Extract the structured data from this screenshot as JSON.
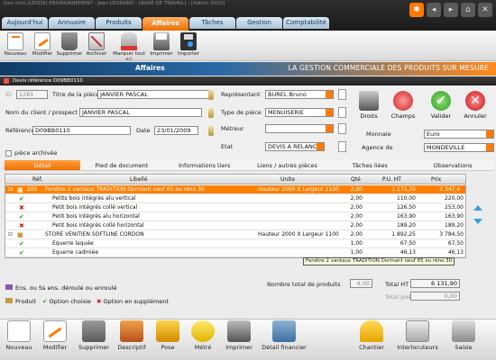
{
  "window": {
    "title": "Gen.com [LEXOS] ENVIRONNEMENT - Jean LEONARD - [BASE DE TRAVAIL] - [Admin 2010]"
  },
  "tabs": [
    "Aujourd'hui",
    "Annuaire",
    "Produits",
    "Affaires",
    "Tâches",
    "Gestion",
    "Comptabilité"
  ],
  "active_tab": "Affaires",
  "toolbar": {
    "items": [
      "Nouveau",
      "Modifier",
      "Supprimer",
      "Archiver",
      "Marquer tout +/-",
      "Imprimer",
      "Importer"
    ]
  },
  "section": {
    "label": "Affaires",
    "slogan": "LA GESTION COMMERCIALE DES PRODUITS SUR MESURE"
  },
  "devis": {
    "title": "Devis référence D09BB0110"
  },
  "form": {
    "id_label": "ID",
    "id_value": "1281",
    "titre_label": "Titre de la pièce",
    "titre_value": "JANVIER PASCAL",
    "client_label": "Nom du client / prospect",
    "client_value": "JANVIER PASCAL",
    "reference_label": "Référence",
    "reference_value": "D09BB0110",
    "date_label": "Date",
    "date_value": "23/01/2009",
    "representant_label": "Représentant",
    "representant_value": "BUREL Bruno",
    "type_label": "Type de pièce",
    "type_value": "MENUISERIE",
    "metreur_label": "Métreur",
    "metreur_value": "",
    "etat_label": "Etat",
    "etat_value": "DEVIS A RELANCER",
    "monnaie_label": "Monnaie",
    "monnaie_value": "Euro",
    "agence_label": "Agence de",
    "agence_value": "MONDEVILLE",
    "archive_label": "pièce archivée"
  },
  "actions": {
    "droits": "Droits",
    "champs": "Champs",
    "valider": "Valider",
    "annuler": "Annuler"
  },
  "subtabs": [
    "Détail",
    "Pied de document",
    "Informations tiers",
    "Liens / autres pièces",
    "Tâches liées",
    "Observations"
  ],
  "grid": {
    "headers": {
      "ref": "Réf.",
      "libelle": "Libellé",
      "unite": "Unite",
      "qte": "Qté",
      "pu": "P.U. HT",
      "prix": "Prix"
    },
    "rows": [
      {
        "mark": "pkg",
        "ref": "205",
        "libelle": "Fenêtre 2 vantaux TRADITION Dormant neuf 65 ou réno 30",
        "unite": "Hauteur 2000 X Largeur 1100",
        "qte": "2,00",
        "pu": "1 173,70",
        "prix": "2 347,40",
        "selected": true
      },
      {
        "mark": "check",
        "ref": "",
        "libelle": "Petits bois intégrés alu vertical",
        "unite": "",
        "qte": "2,00",
        "pu": "110,00",
        "prix": "220,00"
      },
      {
        "mark": "cross",
        "ref": "",
        "libelle": "Petit bois intégrés collé vertical",
        "unite": "",
        "qte": "2,00",
        "pu": "126,50",
        "prix": "253,00"
      },
      {
        "mark": "check",
        "ref": "",
        "libelle": "Petit bois intégrés alu horizontal",
        "unite": "",
        "qte": "2,00",
        "pu": "163,90",
        "prix": "163,90"
      },
      {
        "mark": "cross",
        "ref": "",
        "libelle": "Petit bois intégrés collé horizontal",
        "unite": "",
        "qte": "2,00",
        "pu": "189,20",
        "prix": "189,20"
      },
      {
        "mark": "pkg",
        "ref": "",
        "libelle": "STORE VENITIEN SOFTLINE CORDON",
        "unite": "Hauteur 2000 X Largeur 1100",
        "qte": "2,00",
        "pu": "1 892,25",
        "prix": "3 784,50"
      },
      {
        "mark": "check",
        "ref": "",
        "libelle": "Equerre laquée",
        "unite": "",
        "qte": "1,00",
        "pu": "67,50",
        "prix": "67,50"
      },
      {
        "mark": "check",
        "ref": "",
        "libelle": "Equerre cadmiée",
        "unite": "",
        "qte": "1,00",
        "pu": "46,13",
        "prix": "46,13"
      }
    ]
  },
  "tooltip": "Fenêtre 2 vantaux TRADITION Dormant neuf 65 ou réno 30",
  "legend": {
    "enroule": "Ens. ou Ss ens. déroulé ou enroulé",
    "produit": "Produit",
    "option_choisie": "Option choisie",
    "option_supplement": "Option en supplément"
  },
  "totals": {
    "nb_label": "Nombre total de produits",
    "nb_value": "4,00",
    "total_ht_label": "Total HT",
    "total_ht_value": "6 131,90",
    "total_pose_label": "Total pose",
    "total_pose_value": "0,00"
  },
  "bottom": {
    "items": [
      "Nouveau",
      "Modifier",
      "Supprimer",
      "Descriptif",
      "Pose",
      "Métré",
      "Imprimer",
      "Détail financier"
    ],
    "right_items": [
      "Chantier",
      "Interlocuteurs",
      "Saisie"
    ]
  },
  "colors": {
    "accent": "#ff7a00",
    "selection": "#ff8000",
    "navy": "#0f3b66"
  }
}
